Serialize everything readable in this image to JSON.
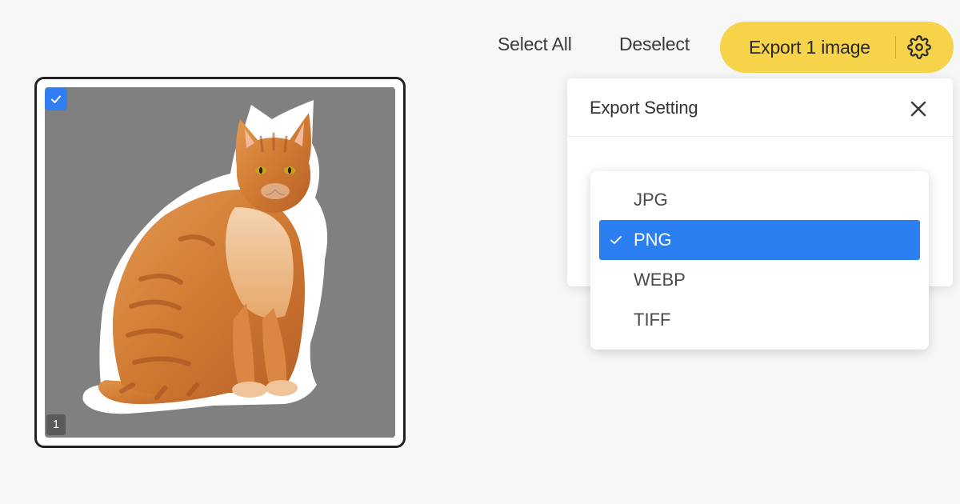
{
  "toolbar": {
    "select_all_label": "Select All",
    "deselect_label": "Deselect",
    "export_label": "Export 1 image",
    "accent_color": "#f7d34a"
  },
  "gallery": {
    "images": [
      {
        "index_label": "1",
        "selected": true,
        "subject": "orange tabby cat sticker",
        "background_color": "#808080"
      }
    ],
    "checkbox_color": "#2f7ff2"
  },
  "export_settings": {
    "title": "Export Setting",
    "close_icon": "close-icon",
    "format_options": [
      "JPG",
      "PNG",
      "WEBP",
      "TIFF"
    ],
    "selected_format": "PNG",
    "selected_color": "#2b7ff0"
  }
}
